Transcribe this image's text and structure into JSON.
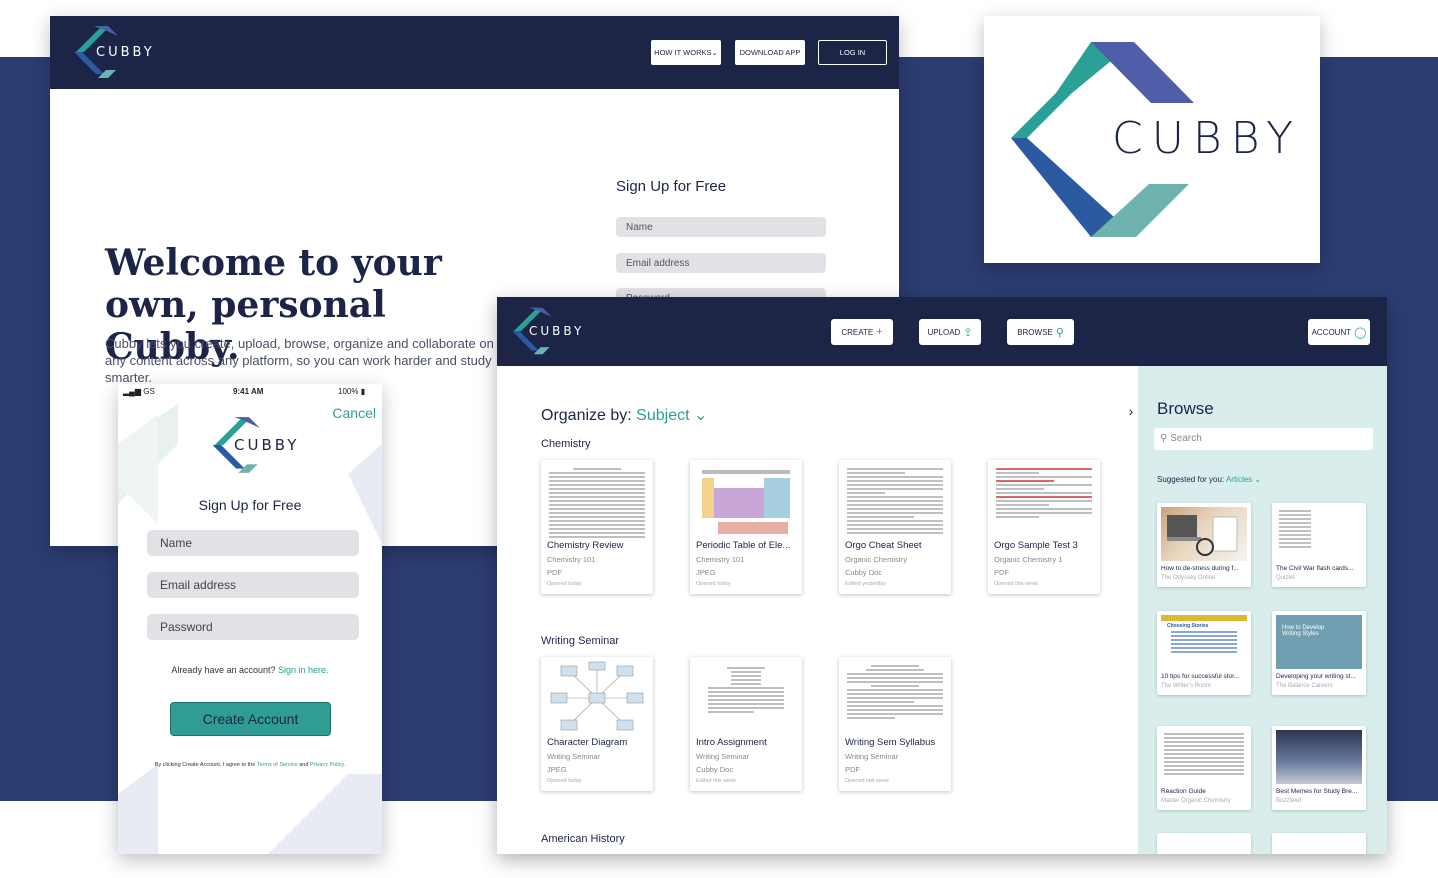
{
  "brand": {
    "name": "CUBBY",
    "colors": {
      "navy": "#1c2448",
      "teal": "#2aa097",
      "band": "#2c3d73",
      "browse_bg": "#d9eeec"
    }
  },
  "landing": {
    "nav": {
      "how": "HOW IT WORKS",
      "download": "DOWNLOAD APP",
      "login": "LOG IN"
    },
    "hero_title": "Welcome to your own, personal Cubby.",
    "hero_body": "Cubby lets you create, upload, browse, organize and collaborate on any content across any platform, so you can work harder and study smarter.",
    "signup_title": "Sign Up for Free",
    "fields": {
      "name": "Name",
      "email": "Email address",
      "password": "Password"
    }
  },
  "mobile": {
    "status": {
      "carrier": "GS",
      "time": "9:41 AM",
      "battery": "100%"
    },
    "cancel": "Cancel",
    "title": "Sign Up for Free",
    "fields": {
      "name": "Name",
      "email": "Email address",
      "password": "Password"
    },
    "already": "Already have an account?",
    "signin": "Sign in here.",
    "create": "Create Account",
    "terms_pre": "By clicking Create Account, I agree to the",
    "terms_tos": "Terms of Service",
    "terms_and": "and",
    "terms_pp": "Privacy Policy."
  },
  "app": {
    "nav": {
      "create": "CREATE",
      "upload": "UPLOAD",
      "browse": "BROWSE",
      "account": "ACCOUNT"
    },
    "organize_label": "Organize by:",
    "organize_value": "Subject",
    "sections": [
      "Chemistry",
      "Writing Seminar",
      "American History"
    ],
    "chemistry": [
      {
        "title": "Chemistry Review",
        "course": "Chemistry 101",
        "type": "PDF",
        "when": "Opened today"
      },
      {
        "title": "Periodic Table of Ele...",
        "course": "Chemistry 101",
        "type": "JPEG",
        "when": "Opened today"
      },
      {
        "title": "Orgo Cheat Sheet",
        "course": "Organic Chemistry",
        "type": "Cubby Doc",
        "when": "Edited yesterday"
      },
      {
        "title": "Orgo Sample Test 3",
        "course": "Organic Chemistry 1",
        "type": "PDF",
        "when": "Opened this week"
      }
    ],
    "writing": [
      {
        "title": "Character Diagram",
        "course": "Writing Seminar",
        "type": "JPEG",
        "when": "Opened today"
      },
      {
        "title": "Intro Assignment",
        "course": "Writing Seminar",
        "type": "Cubby Doc",
        "when": "Edited this week"
      },
      {
        "title": "Writing Sem Syllabus",
        "course": "Writing Seminar",
        "type": "PDF",
        "when": "Opened last week"
      }
    ],
    "browse": {
      "title": "Browse",
      "search_placeholder": "Search",
      "suggested": "Suggested for you:",
      "suggested_value": "Articles",
      "items": [
        {
          "title": "How to de-stress during f...",
          "source": "The Odyssey Online"
        },
        {
          "title": "The Civil War flash cards...",
          "source": "Quizlet"
        },
        {
          "title": "10 tips for successful stor...",
          "source": "The Writer's Room"
        },
        {
          "title": "Developing your writing st...",
          "source": "The Balance Careers"
        },
        {
          "title": "Reaction Guide",
          "source": "Master Organic Chemistry"
        },
        {
          "title": "Best Memes for Study Bre...",
          "source": "Buzzfeed"
        }
      ],
      "thumb_text": {
        "stories": "Choosing Stories",
        "develop": "How to Develop Writing Styles"
      }
    }
  }
}
